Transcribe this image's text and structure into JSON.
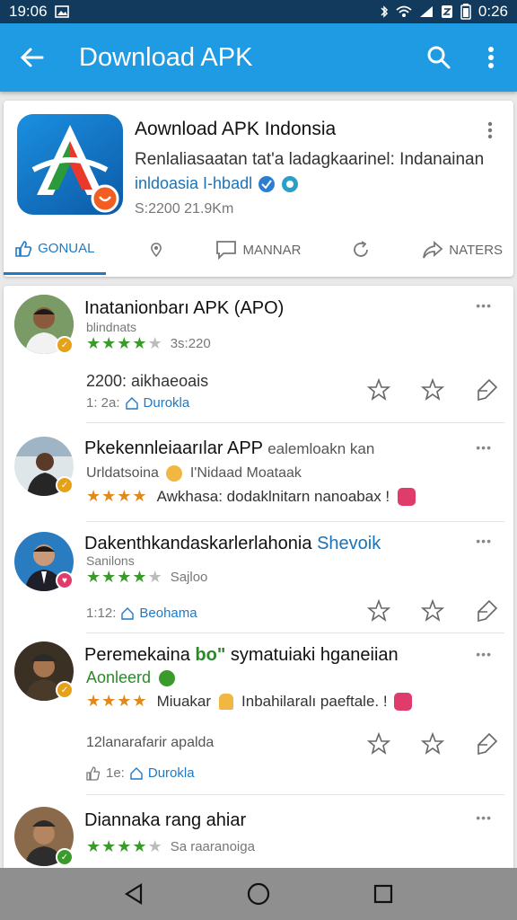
{
  "status": {
    "time": "19:06",
    "clock_right": "0:26"
  },
  "appbar": {
    "title": "Download APK"
  },
  "app": {
    "name": "Aownload APK Indonsia",
    "description": "Renlaliasaatan tat'a ladagkaarinel: Indanainan",
    "link": "inldoasia I-hbadl",
    "meta": "S:2200 21.9Km"
  },
  "tabs": [
    {
      "label": "GONUAL"
    },
    {
      "label": ""
    },
    {
      "label": "MANNAR"
    },
    {
      "label": ""
    },
    {
      "label": "NATERS"
    }
  ],
  "posts": [
    {
      "title": "Inatanionbarı APK (APO)",
      "sub": "blindnats",
      "rating": 4,
      "rating_text": "3s:220",
      "body": "2200: aikhaeoais",
      "meta_left": "1: 2a:",
      "meta_link": "Durokla",
      "badge_color": "#e6a11b"
    },
    {
      "title": "Pkekennleiaarılar APP",
      "title_link": "ealemloakn kan",
      "sub": "Urldatsoina",
      "sub2": "I'Nidaad Moataak",
      "rating": 3.5,
      "body": "Awkhasa: dodaklnitarn nanoabax !",
      "badge_color": "#e6a11b"
    },
    {
      "title": "Dakenthkandaskarlerlahonia",
      "title_link": "Shevoik",
      "sub": "Sanilons",
      "rating": 4,
      "rating_text": "Sajloo",
      "meta_left": "1:12:",
      "meta_link": "Beohama",
      "badge_color": "#e03c6b"
    },
    {
      "title": "Peremekaina",
      "title_bold": "bo\"",
      "title_rest": "symatuiaki hganeiian",
      "sub_link": "Aonleerd",
      "rating": 3.5,
      "body": "Miuakar",
      "body2": "Inbahilaralı paeftale. !",
      "meta_top": "12lanarafarir apalda",
      "meta_left": "1e:",
      "meta_link": "Durokla",
      "badge_color": "#e6a11b"
    },
    {
      "title": "Diannaka rang ahiar",
      "rating": 4,
      "rating_text": "Sa raaranoiga",
      "badge_color": "#3a9a2a"
    }
  ]
}
